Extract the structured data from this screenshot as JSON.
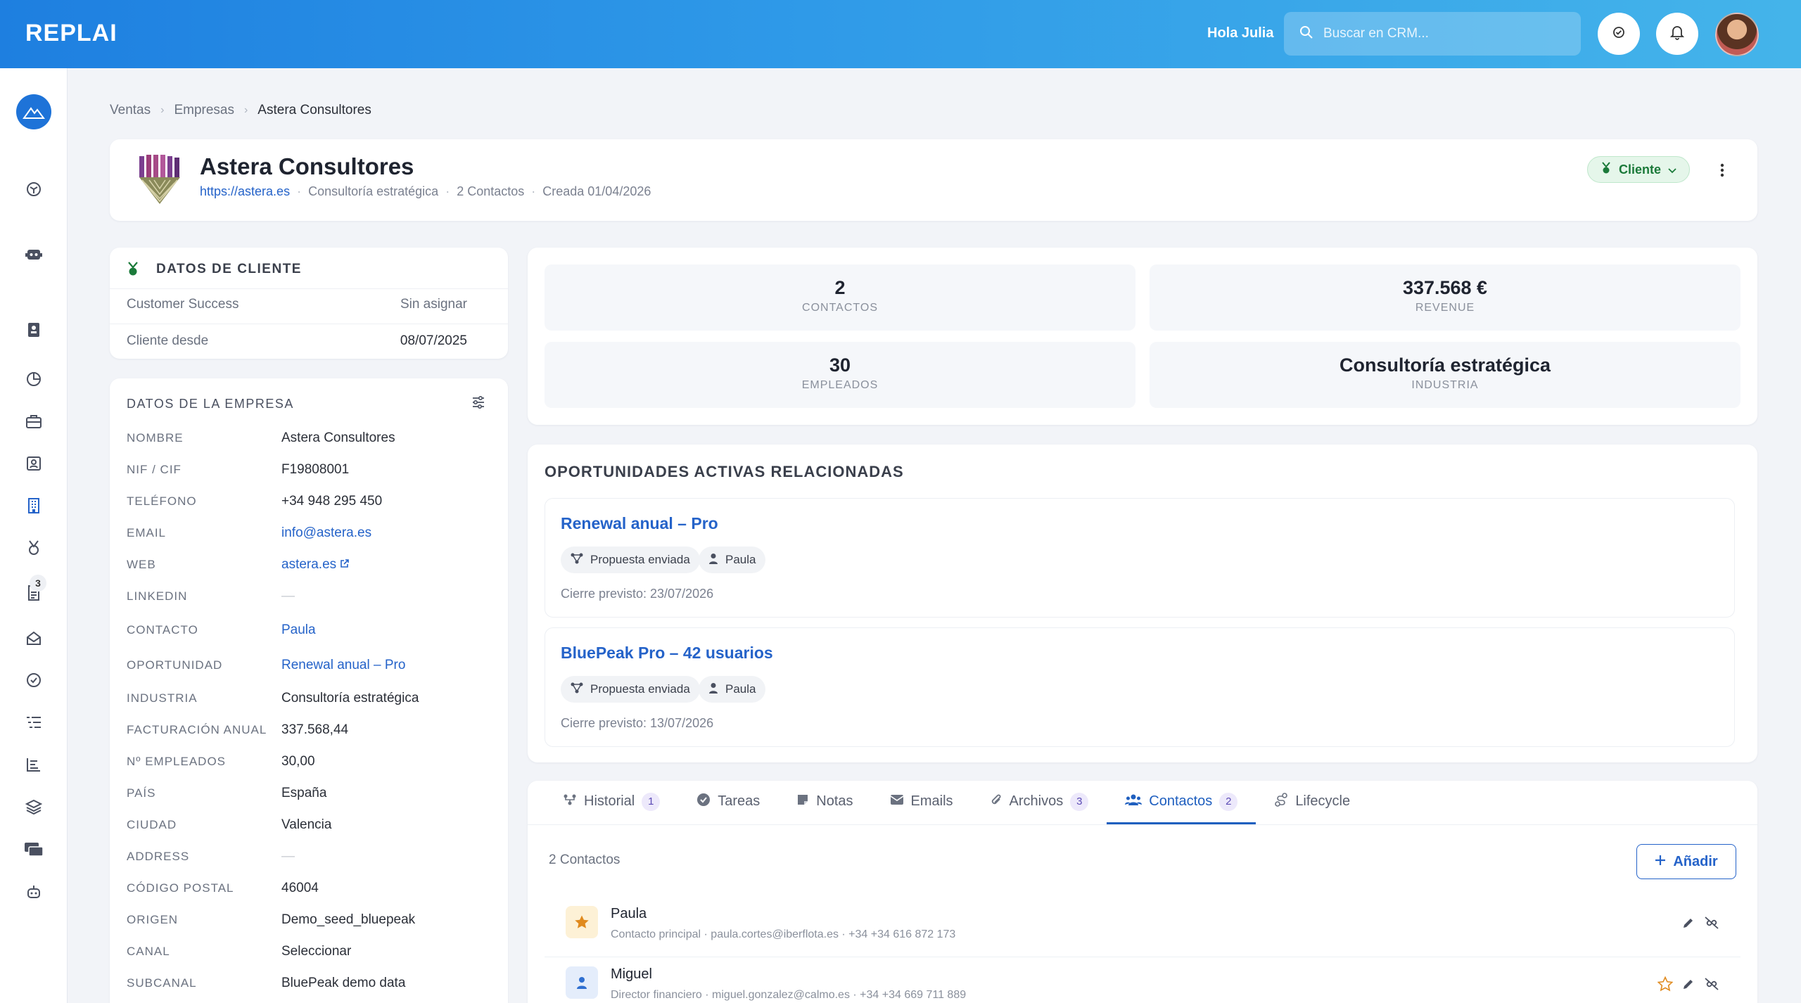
{
  "app": {
    "logo": "REPLAI"
  },
  "topbar": {
    "greeting": "Hola Julia",
    "search_placeholder": "Buscar en CRM..."
  },
  "sidebar": {
    "badge_count": "3"
  },
  "breadcrumb": {
    "items": [
      "Ventas",
      "Empresas",
      "Astera Consultores"
    ]
  },
  "company": {
    "name": "Astera Consultores",
    "url": "https://astera.es",
    "industry": "Consultoría estratégica",
    "contacts": "2 Contactos",
    "created": "Creada 01/04/2026",
    "status": "Cliente"
  },
  "client_data": {
    "title": "DATOS DE CLIENTE",
    "rows": [
      {
        "label": "Customer Success",
        "value": "Sin asignar"
      },
      {
        "label": "Cliente desde",
        "value": "08/07/2025"
      }
    ]
  },
  "company_data": {
    "title": "DATOS DE LA EMPRESA",
    "rows": [
      {
        "label": "NOMBRE",
        "value": "Astera Consultores"
      },
      {
        "label": "NIF / CIF",
        "value": "F19808001"
      },
      {
        "label": "TELÉFONO",
        "value": "+34 948 295 450"
      },
      {
        "label": "EMAIL",
        "value": "info@astera.es"
      },
      {
        "label": "WEB",
        "value": "astera.es"
      },
      {
        "label": "LINKEDIN",
        "value": "—"
      },
      {
        "label": "CONTACTO",
        "value": "Paula"
      },
      {
        "label": "OPORTUNIDAD",
        "value": "Renewal anual – Pro"
      },
      {
        "label": "INDUSTRIA",
        "value": "Consultoría estratégica"
      },
      {
        "label": "FACTURACIÓN ANUAL",
        "value": "337.568,44"
      },
      {
        "label": "Nº EMPLEADOS",
        "value": "30,00"
      },
      {
        "label": "PAÍS",
        "value": "España"
      },
      {
        "label": "CIUDAD",
        "value": "Valencia"
      },
      {
        "label": "ADDRESS",
        "value": "—"
      },
      {
        "label": "CÓDIGO POSTAL",
        "value": "46004"
      },
      {
        "label": "ORIGEN",
        "value": "Demo_seed_bluepeak"
      },
      {
        "label": "CANAL",
        "value": "Seleccionar"
      },
      {
        "label": "SUBCANAL",
        "value": "BluePeak demo data"
      }
    ]
  },
  "stats": [
    {
      "value": "2",
      "label": "CONTACTOS"
    },
    {
      "value": "337.568 €",
      "label": "REVENUE"
    },
    {
      "value": "30",
      "label": "EMPLEADOS"
    },
    {
      "value": "Consultoría estratégica",
      "label": "INDUSTRIA"
    }
  ],
  "opportunities": {
    "title": "OPORTUNIDADES ACTIVAS RELACIONADAS",
    "items": [
      {
        "name": "Renewal anual – Pro",
        "stage": "Propuesta enviada",
        "owner": "Paula",
        "close": "Cierre previsto: 23/07/2026"
      },
      {
        "name": "BluePeak Pro – 42 usuarios",
        "stage": "Propuesta enviada",
        "owner": "Paula",
        "close": "Cierre previsto: 13/07/2026"
      }
    ]
  },
  "tabs": [
    {
      "label": "Historial",
      "count": "1"
    },
    {
      "label": "Tareas",
      "count": ""
    },
    {
      "label": "Notas",
      "count": ""
    },
    {
      "label": "Emails",
      "count": ""
    },
    {
      "label": "Archivos",
      "count": "3"
    },
    {
      "label": "Contactos",
      "count": "2"
    },
    {
      "label": "Lifecycle",
      "count": ""
    }
  ],
  "contacts_panel": {
    "count_label": "2 Contactos",
    "add_label": "Añadir",
    "items": [
      {
        "name": "Paula",
        "detail": "Contacto principal · paula.cortes@iberflota.es · +34 +34 616 872 173"
      },
      {
        "name": "Miguel",
        "detail": "Director financiero · miguel.gonzalez@calmo.es · +34 +34 669 711 889"
      }
    ]
  },
  "colors": {
    "primary": "#2563c9",
    "topbar_start": "#1e7fe0",
    "topbar_end": "#44b4ea",
    "status_green": "#1b7a3a"
  }
}
